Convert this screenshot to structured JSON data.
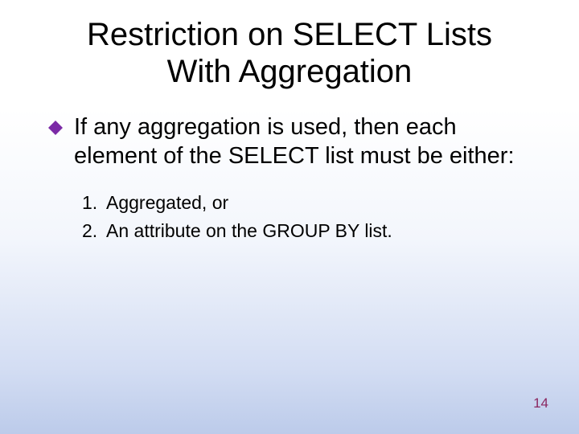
{
  "title_line1": "Restriction on SELECT Lists",
  "title_line2": "With Aggregation",
  "bullet": "If any aggregation is used, then each element of the SELECT list must be either:",
  "items": [
    {
      "n": "1.",
      "text": "Aggregated, or"
    },
    {
      "n": "2.",
      "text": "An attribute on the GROUP BY list."
    }
  ],
  "page": "14",
  "colors": {
    "diamond": "#7b2aa6",
    "pagenum": "#8a265f"
  }
}
